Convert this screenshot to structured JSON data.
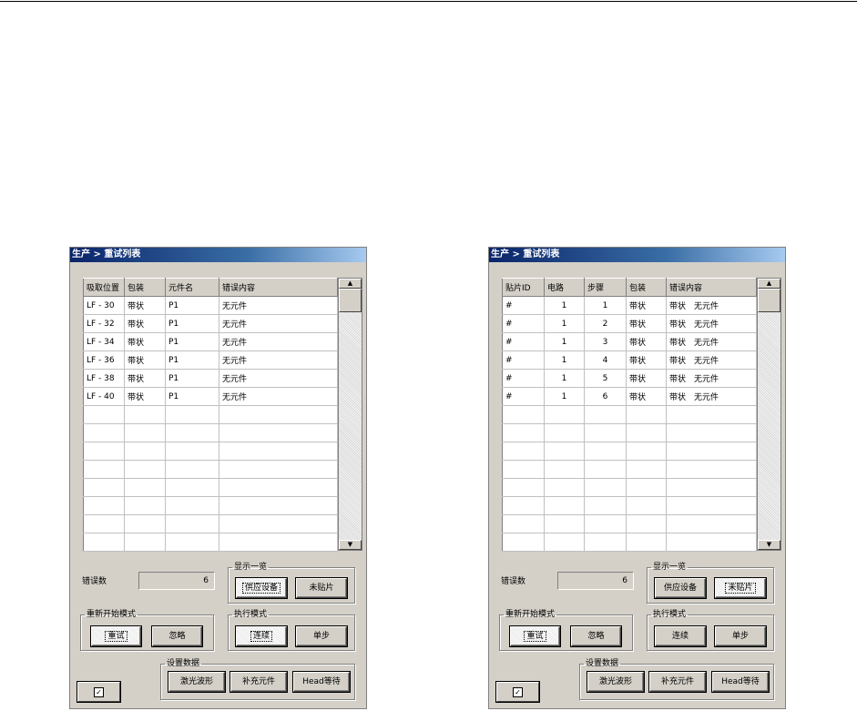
{
  "left": {
    "title": "生产 > 重试列表",
    "columns": [
      "吸取位置",
      "包装",
      "元件名",
      "错误内容"
    ],
    "rows": [
      [
        "LF - 30",
        "带状",
        "P1",
        "无元件"
      ],
      [
        "LF - 32",
        "带状",
        "P1",
        "无元件"
      ],
      [
        "LF - 34",
        "带状",
        "P1",
        "无元件"
      ],
      [
        "LF - 36",
        "带状",
        "P1",
        "无元件"
      ],
      [
        "LF - 38",
        "带状",
        "P1",
        "无元件"
      ],
      [
        "LF - 40",
        "带状",
        "P1",
        "无元件"
      ]
    ],
    "error_count_label": "错误数",
    "error_count": "6",
    "display_group": "显示一览",
    "supply_btn": "供应设备",
    "unplaced_btn": "未贴片",
    "restart_group": "重新开始模式",
    "retry_btn": "重试",
    "ignore_btn": "忽略",
    "exec_group": "执行模式",
    "continuous_btn": "连续",
    "step_btn": "单步",
    "settings_group": "设置数据",
    "laser_btn": "激光波形",
    "refill_btn": "补充元件",
    "head_btn": "Head等待",
    "selected_display": "supply"
  },
  "right": {
    "title": "生产 > 重试列表",
    "columns": [
      "贴片ID",
      "电路",
      "步骤",
      "包装",
      "错误内容"
    ],
    "rows": [
      [
        "#",
        "1",
        "1",
        "带状",
        "带状　无元件"
      ],
      [
        "#",
        "1",
        "2",
        "带状",
        "带状　无元件"
      ],
      [
        "#",
        "1",
        "3",
        "带状",
        "带状　无元件"
      ],
      [
        "#",
        "1",
        "4",
        "带状",
        "带状　无元件"
      ],
      [
        "#",
        "1",
        "5",
        "带状",
        "带状　无元件"
      ],
      [
        "#",
        "1",
        "6",
        "带状",
        "带状　无元件"
      ]
    ],
    "error_count_label": "错误数",
    "error_count": "6",
    "display_group": "显示一览",
    "supply_btn": "供应设备",
    "unplaced_btn": "未贴片",
    "restart_group": "重新开始模式",
    "retry_btn": "重试",
    "ignore_btn": "忽略",
    "exec_group": "执行模式",
    "continuous_btn": "连续",
    "step_btn": "单步",
    "settings_group": "设置数据",
    "laser_btn": "激光波形",
    "refill_btn": "补充元件",
    "head_btn": "Head等待",
    "selected_display": "unplaced"
  },
  "icons": {
    "checkbox": "check-icon",
    "scroll_up": "arrow-up-icon",
    "scroll_down": "arrow-down-icon"
  }
}
